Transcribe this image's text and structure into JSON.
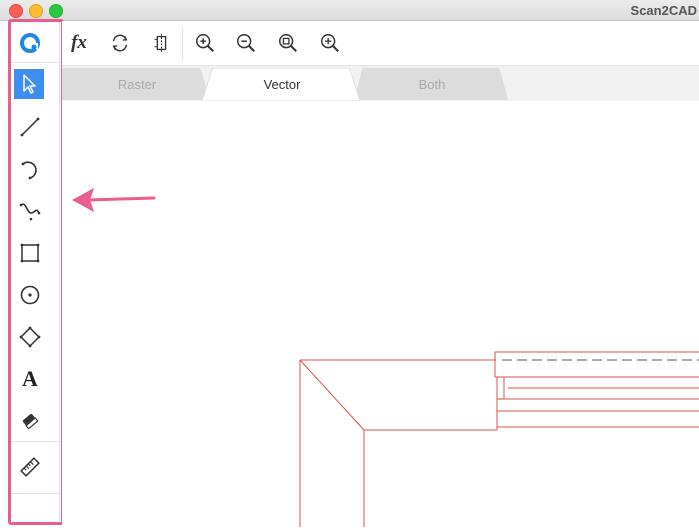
{
  "window": {
    "title": "Scan2CAD"
  },
  "sidebar": {
    "tools": [
      {
        "icon": "scan2cad-logo-icon",
        "name": "app-logo"
      },
      {
        "icon": "select-cursor-icon",
        "name": "select-tool",
        "active": true
      },
      {
        "icon": "line-icon",
        "name": "line-tool"
      },
      {
        "icon": "arc-icon",
        "name": "arc-tool"
      },
      {
        "icon": "curve-icon",
        "name": "curve-tool"
      },
      {
        "icon": "rectangle-icon",
        "name": "rectangle-tool"
      },
      {
        "icon": "circle-icon",
        "name": "circle-tool"
      },
      {
        "icon": "polygon-icon",
        "name": "polygon-tool"
      },
      {
        "icon": "text-tool-icon",
        "name": "text-tool",
        "glyph": "A"
      },
      {
        "icon": "eraser-icon",
        "name": "eraser-tool"
      },
      {
        "icon": "ruler-icon",
        "name": "measure-tool"
      }
    ]
  },
  "toolbar": {
    "buttons": [
      {
        "icon": "function-icon",
        "label": "fx"
      },
      {
        "icon": "rotate-icon"
      },
      {
        "icon": "mirror-icon"
      },
      {
        "icon": "zoom-in-icon"
      },
      {
        "icon": "zoom-out-icon"
      },
      {
        "icon": "zoom-fit-icon"
      },
      {
        "icon": "zoom-extents-icon"
      }
    ]
  },
  "tabs": [
    {
      "label": "Raster",
      "active": false
    },
    {
      "label": "Vector",
      "active": true
    },
    {
      "label": "Both",
      "active": false
    }
  ],
  "annotation": {
    "highlight_color": "#e95d8f",
    "arrow_color": "#e95d8f"
  },
  "colors": {
    "accent": "#3d8ef0",
    "drawing_line": "#d9534f"
  }
}
